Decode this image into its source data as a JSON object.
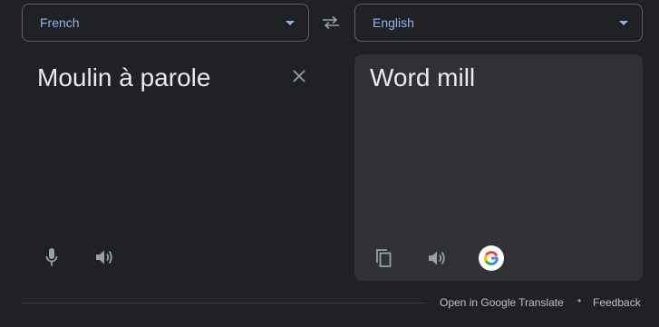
{
  "source": {
    "language": "French",
    "text": "Moulin à parole"
  },
  "target": {
    "language": "English",
    "text": "Word mill"
  },
  "icons": {
    "swap": "swap-icon",
    "clear": "close-icon",
    "mic": "microphone-icon",
    "speak": "speaker-icon",
    "copy": "copy-icon",
    "google": "google-logo-icon"
  },
  "footer": {
    "open_link": "Open in Google Translate",
    "separator": "•",
    "feedback": "Feedback"
  },
  "colors": {
    "background": "#202124",
    "panel": "#303134",
    "accent": "#8ab4f8",
    "text": "#e8eaed"
  }
}
